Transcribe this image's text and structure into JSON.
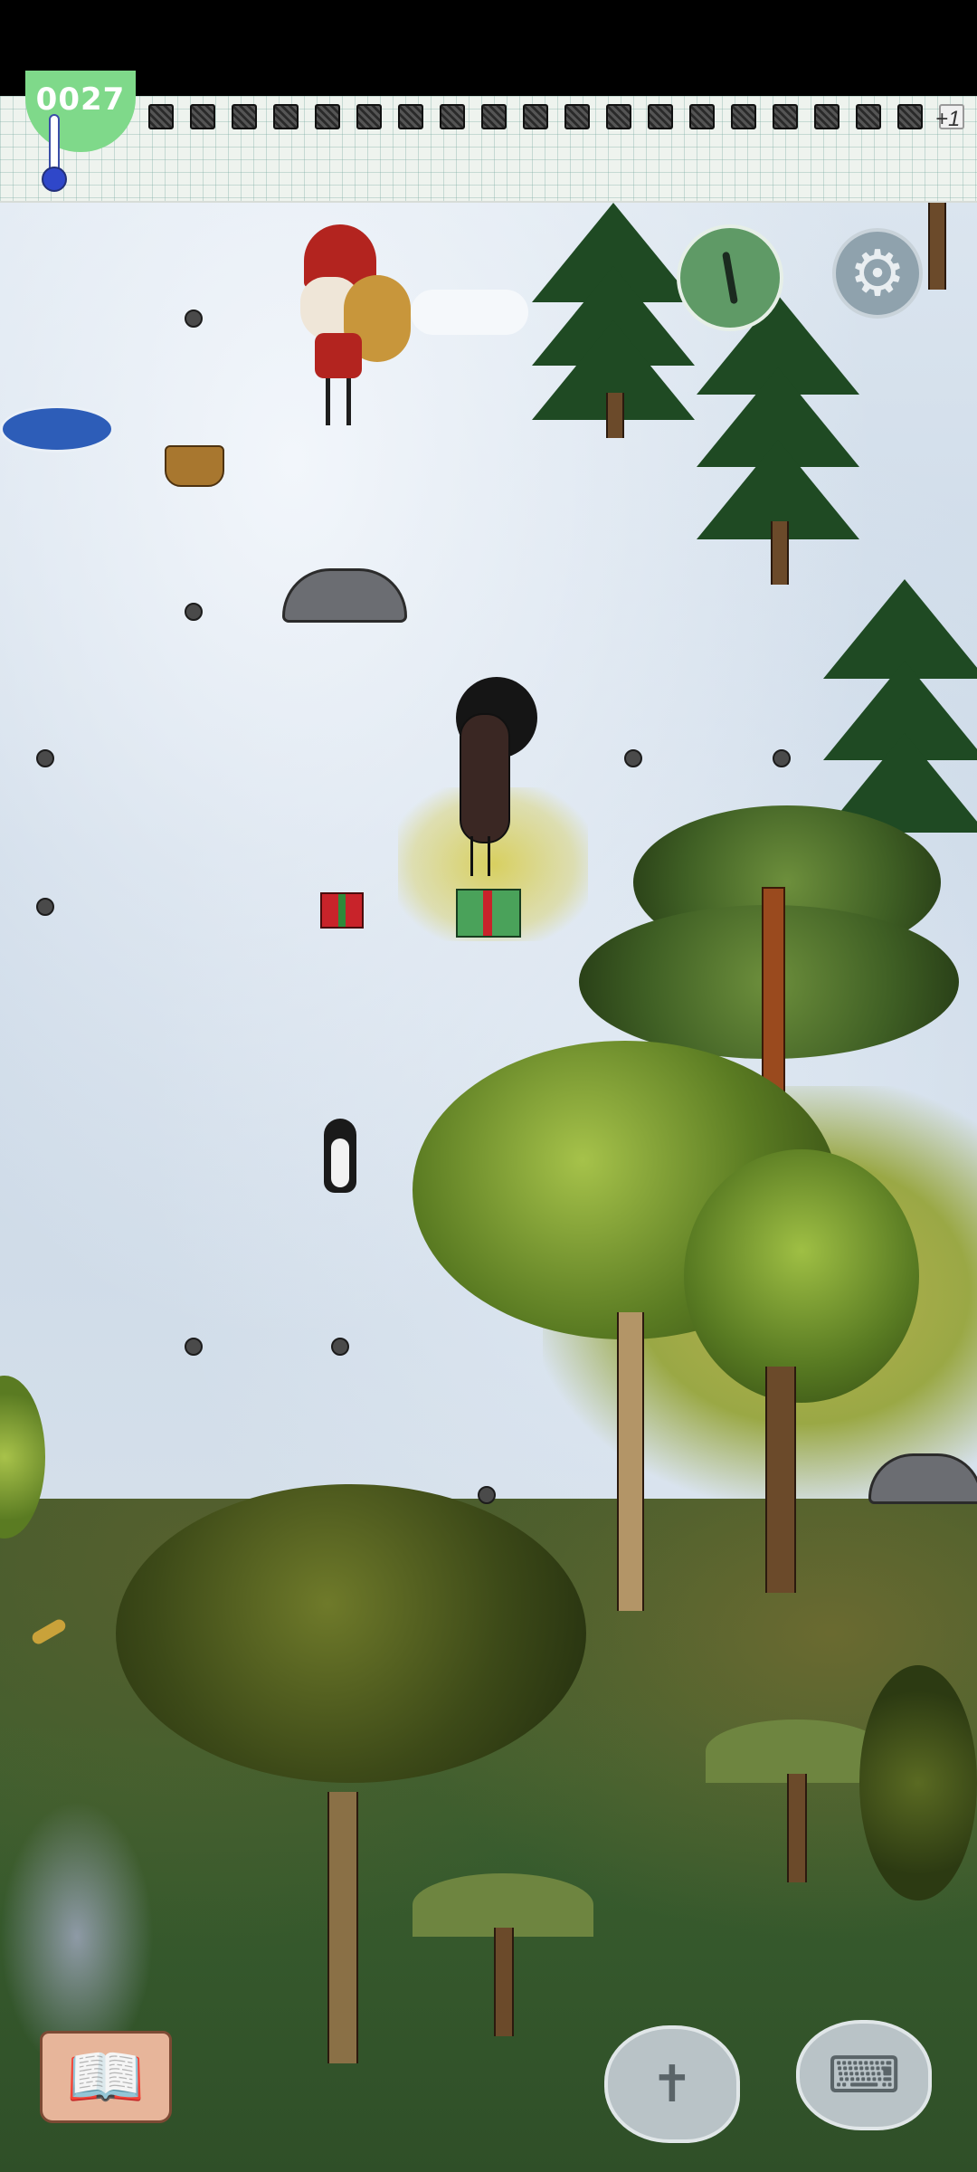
{
  "hud": {
    "food_value": "0027",
    "bonus_label": "+1",
    "food_pips": [
      "full",
      "full",
      "full",
      "full",
      "full",
      "full",
      "full",
      "full",
      "full",
      "full",
      "full",
      "full",
      "full",
      "full",
      "full",
      "full",
      "full",
      "full",
      "full",
      "empty"
    ],
    "temperature_level": 0.1
  },
  "world": {
    "biomes": [
      "snow",
      "jungle"
    ],
    "characters": [
      "santa",
      "player-eve",
      "penguin"
    ],
    "items": [
      "gift-red",
      "gift-green",
      "basket",
      "ice-hole",
      "big-rock",
      "stones"
    ]
  },
  "buttons": {
    "compass_icon": "compass-icon",
    "settings_icon": "gear-icon",
    "recipe_icon": "book-icon",
    "puppet_icon": "puppet-icon",
    "keyboard_icon": "keyboard-icon"
  },
  "colors": {
    "food_badge": "#7fd98a",
    "compass": "#5f9a66",
    "settings": "#8fa2ad",
    "snow": "#d4dfea",
    "jungle": "#3a5f2f"
  }
}
